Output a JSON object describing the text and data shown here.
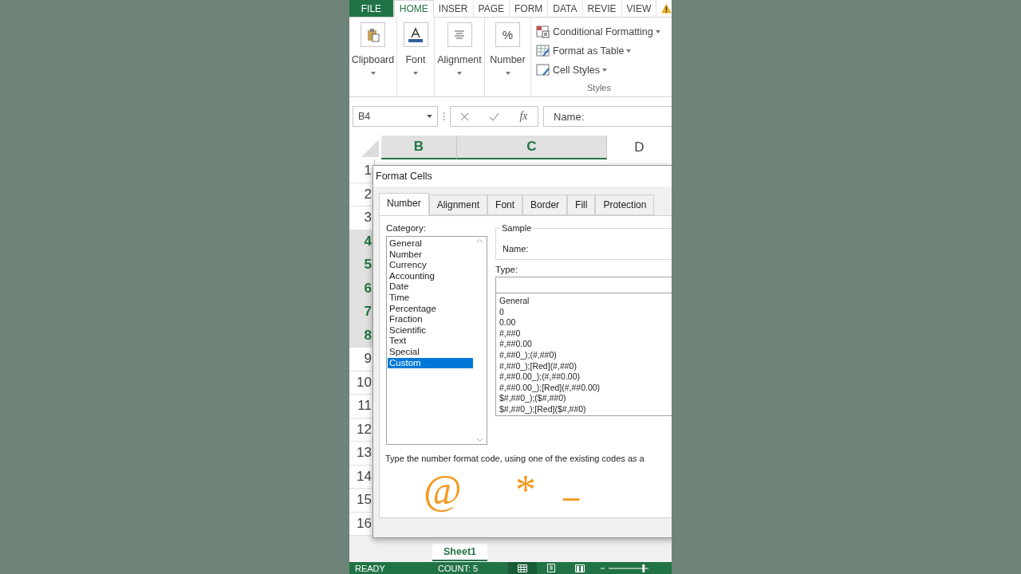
{
  "ribbon_tabs": [
    {
      "label": "FILE",
      "kind": "file",
      "selected": false
    },
    {
      "label": "HOME",
      "kind": "tab",
      "selected": true
    },
    {
      "label": "INSER",
      "kind": "tab",
      "selected": false
    },
    {
      "label": "PAGE",
      "kind": "tab",
      "selected": false
    },
    {
      "label": "FORM",
      "kind": "tab",
      "selected": false
    },
    {
      "label": "DATA",
      "kind": "tab",
      "selected": false
    },
    {
      "label": "REVIE",
      "kind": "tab",
      "selected": false
    },
    {
      "label": "VIEW",
      "kind": "tab",
      "selected": false
    }
  ],
  "ribbon_groups": [
    {
      "label": "Clipboard",
      "kind": "clipboard"
    },
    {
      "label": "Font",
      "kind": "font"
    },
    {
      "label": "Alignment",
      "kind": "alignment"
    },
    {
      "label": "Number",
      "kind": "number",
      "glyph": "%"
    }
  ],
  "styles_group": {
    "label": "Styles",
    "items": [
      {
        "label": "Conditional Formatting",
        "kind": "conditional"
      },
      {
        "label": "Format as Table",
        "kind": "table"
      },
      {
        "label": "Cell Styles",
        "kind": "styles"
      }
    ]
  },
  "formula_bar": {
    "name_box": "B4",
    "fx": "fx",
    "value": "Name:"
  },
  "columns": [
    {
      "label": "B",
      "selected": true
    },
    {
      "label": "C",
      "selected": true
    },
    {
      "label": "D",
      "selected": false
    }
  ],
  "rows": [
    {
      "label": "1",
      "selected": false
    },
    {
      "label": "2",
      "selected": false
    },
    {
      "label": "3",
      "selected": false
    },
    {
      "label": "4",
      "selected": true
    },
    {
      "label": "5",
      "selected": true
    },
    {
      "label": "6",
      "selected": true
    },
    {
      "label": "7",
      "selected": true
    },
    {
      "label": "8",
      "selected": true
    },
    {
      "label": "9",
      "selected": false
    },
    {
      "label": "10",
      "selected": false
    },
    {
      "label": "11",
      "selected": false
    },
    {
      "label": "12",
      "selected": false
    },
    {
      "label": "13",
      "selected": false
    },
    {
      "label": "14",
      "selected": false
    },
    {
      "label": "15",
      "selected": false
    },
    {
      "label": "16",
      "selected": false
    }
  ],
  "dialog": {
    "title": "Format Cells",
    "tabs": [
      {
        "label": "Number",
        "selected": true
      },
      {
        "label": "Alignment",
        "selected": false
      },
      {
        "label": "Font",
        "selected": false
      },
      {
        "label": "Border",
        "selected": false
      },
      {
        "label": "Fill",
        "selected": false
      },
      {
        "label": "Protection",
        "selected": false
      }
    ],
    "category_label": "Category:",
    "categories": [
      {
        "label": "General",
        "selected": false
      },
      {
        "label": "Number",
        "selected": false
      },
      {
        "label": "Currency",
        "selected": false
      },
      {
        "label": "Accounting",
        "selected": false
      },
      {
        "label": "Date",
        "selected": false
      },
      {
        "label": "Time",
        "selected": false
      },
      {
        "label": "Percentage",
        "selected": false
      },
      {
        "label": "Fraction",
        "selected": false
      },
      {
        "label": "Scientific",
        "selected": false
      },
      {
        "label": "Text",
        "selected": false
      },
      {
        "label": "Special",
        "selected": false
      },
      {
        "label": "Custom",
        "selected": true
      }
    ],
    "sample_label": "Sample",
    "sample_value": "Name:",
    "type_label": "Type:",
    "type_codes": [
      "General",
      "0",
      "0.00",
      "#,##0",
      "#,##0.00",
      "#,##0_);(#,##0)",
      "#,##0_);[Red](#,##0)",
      "#,##0.00_);(#,##0.00)",
      "#,##0.00_);[Red](#,##0.00)",
      "$#,##0_);($#,##0)",
      "$#,##0_);[Red]($#,##0)"
    ],
    "description": "Type the number format code, using one of the existing codes as a"
  },
  "overlay": [
    "@",
    "*",
    "_"
  ],
  "sheet_tabs": [
    {
      "label": "Sheet1",
      "selected": true
    }
  ],
  "status_bar": {
    "status": "READY",
    "count": "COUNT: 5",
    "zoom": {
      "level": 0.9
    },
    "views": [
      {
        "kind": "normal",
        "selected": true
      },
      {
        "kind": "layout",
        "selected": false
      },
      {
        "kind": "break",
        "selected": false
      }
    ]
  }
}
